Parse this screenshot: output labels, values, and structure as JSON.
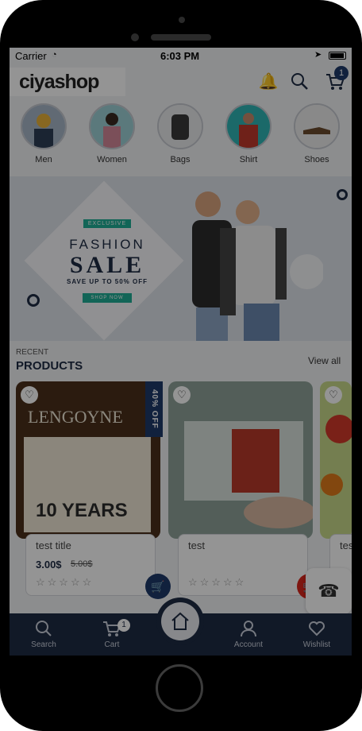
{
  "status_bar": {
    "carrier": "Carrier",
    "time": "6:03 PM"
  },
  "header": {
    "logo_text": "ciyashop",
    "cart_count": "1"
  },
  "categories": [
    {
      "label": "Men",
      "color": "#e8b23a"
    },
    {
      "label": "Women",
      "color": "#d4899a"
    },
    {
      "label": "Bags",
      "color": "#3a3a3a"
    },
    {
      "label": "Shirt",
      "color": "#c0392b"
    },
    {
      "label": "Shoes",
      "color": "#6b4a2e"
    }
  ],
  "banner": {
    "badge": "EXCLUSIVE",
    "line1": "FASHION",
    "line2": "SALE",
    "line3": "SAVE UP TO 50% OFF",
    "cta": "SHOP NOW"
  },
  "section": {
    "small": "RECENT",
    "title": "PRODUCTS",
    "view_all": "View all"
  },
  "products": [
    {
      "title": "test title",
      "price": "3.00$",
      "old_price": "5.00$",
      "discount": "40% OFF",
      "stars": "☆☆☆☆☆",
      "cart_color": "#1e3a6a"
    },
    {
      "title": "test",
      "price": "",
      "old_price": "",
      "stars": "☆☆☆☆☆",
      "cart_color": "#d9261c"
    },
    {
      "title": "test",
      "price": "",
      "old_price": "",
      "stars": ""
    }
  ],
  "bottom_nav": {
    "search": "Search",
    "cart": "Cart",
    "cart_count": "1",
    "account": "Account",
    "wishlist": "Wishlist"
  }
}
